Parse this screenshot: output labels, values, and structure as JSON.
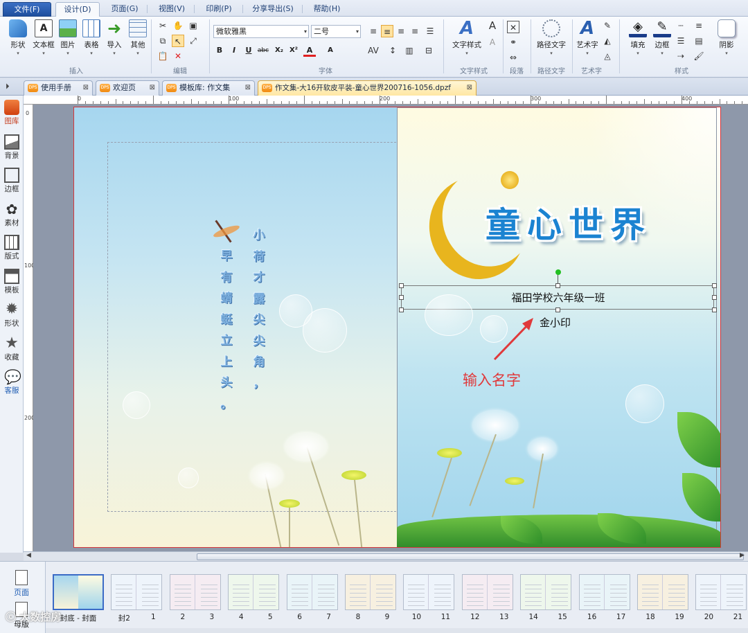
{
  "menu": {
    "tabs": [
      "文件(F)",
      "设计(D)",
      "页面(G)",
      "视图(V)",
      "印刷(P)",
      "分享导出(S)",
      "帮助(H)"
    ]
  },
  "ribbon": {
    "insert": {
      "label": "插入",
      "buttons": [
        "形状",
        "文本框",
        "图片",
        "表格",
        "导入",
        "其他"
      ]
    },
    "edit": {
      "label": "编辑"
    },
    "font": {
      "label": "字体",
      "font_name": "微软雅黑",
      "font_size": "二号",
      "styles": [
        "B",
        "I",
        "U",
        "abc",
        "X₂",
        "X²",
        "A",
        "A"
      ]
    },
    "text_style": {
      "label": "文字样式",
      "button": "文字样式"
    },
    "paragraph": {
      "label": "段落"
    },
    "path_text": {
      "label": "路径文字",
      "button": "路径文字"
    },
    "art_text": {
      "label": "艺术字",
      "button": "艺术字"
    },
    "style": {
      "label": "样式",
      "buttons": [
        "填充",
        "边框",
        "阴影"
      ]
    }
  },
  "doc_tabs": [
    {
      "label": "使用手册"
    },
    {
      "label": "欢迎页"
    },
    {
      "label": "模板库: 作文集"
    },
    {
      "label": "作文集-大16开软皮平装-童心世界200716-1056.dpzf"
    }
  ],
  "tab_icon_text": "DPS",
  "sidebar": [
    {
      "label": "图库",
      "icon": "gallery-icon"
    },
    {
      "label": "背景",
      "icon": "background-icon"
    },
    {
      "label": "边框",
      "icon": "border-icon"
    },
    {
      "label": "素材",
      "icon": "material-icon"
    },
    {
      "label": "版式",
      "icon": "layout-icon"
    },
    {
      "label": "模板",
      "icon": "template-icon"
    },
    {
      "label": "形状",
      "icon": "shape-icon"
    },
    {
      "label": "收藏",
      "icon": "favorite-icon"
    },
    {
      "label": "客服",
      "icon": "service-icon"
    }
  ],
  "ruler": {
    "marks": [
      "0",
      "100",
      "200",
      "300",
      "400"
    ],
    "vmarks": [
      "0",
      "100",
      "200"
    ]
  },
  "page": {
    "poem_columns": [
      "小荷才露尖尖角，",
      "早有蜻蜓立上头。"
    ],
    "title_chars": [
      "童",
      "心",
      "世",
      "界"
    ],
    "school": "福田学校六年级一班",
    "name": "金小印",
    "annotation": "输入名字"
  },
  "bottom": {
    "sidebar": [
      {
        "label": "页面"
      },
      {
        "label": "母版"
      }
    ],
    "thumbs": [
      "封底 - 封面",
      "封2",
      "1",
      "2",
      "3",
      "4",
      "5",
      "6",
      "7",
      "8",
      "9",
      "10",
      "11",
      "12",
      "13",
      "14",
      "15",
      "16",
      "17",
      "18",
      "19",
      "20",
      "21"
    ]
  },
  "watermark": "大数控房",
  "colors": {
    "accent": "#1e5cb3",
    "selection_red": "#d4363a",
    "annotation_red": "#e0393b",
    "title_blue": "#1b83d1"
  }
}
